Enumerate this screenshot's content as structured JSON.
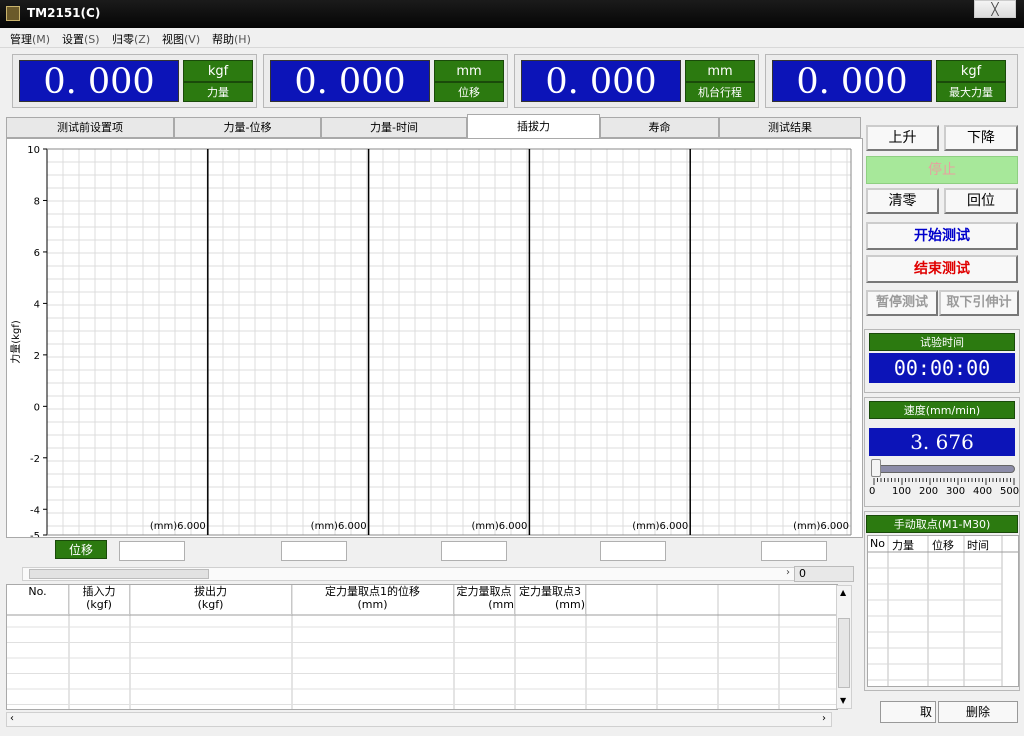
{
  "window": {
    "title": "TM2151(C)",
    "close": "╳"
  },
  "menu": [
    {
      "label": "管理",
      "acc": "(M)"
    },
    {
      "label": "设置",
      "acc": "(S)"
    },
    {
      "label": "归零",
      "acc": "(Z)"
    },
    {
      "label": "视图",
      "acc": "(V)"
    },
    {
      "label": "帮助",
      "acc": "(H)"
    }
  ],
  "displays": [
    {
      "value": "0. 000",
      "unit": "kgf",
      "label": "力量"
    },
    {
      "value": "0. 000",
      "unit": "mm",
      "label": "位移"
    },
    {
      "value": "0. 000",
      "unit": "mm",
      "label": "机台行程"
    },
    {
      "value": "0. 000",
      "unit": "kgf",
      "label": "最大力量"
    }
  ],
  "tabs": [
    "测试前设置项",
    "力量-位移",
    "力量-时间",
    "插拔力",
    "寿命",
    "测试结果"
  ],
  "active_tab": "插拔力",
  "chart_data": {
    "type": "line",
    "ylabel": "力量(kgf)",
    "ylim": [
      -5,
      10
    ],
    "y_ticks": [
      "10",
      "8",
      "6",
      "4",
      "2",
      "0",
      "-2",
      "-4",
      "-5"
    ],
    "x_panel_labels": [
      "(mm)6.000",
      "(mm)6.000",
      "(mm)6.000",
      "(mm)6.000",
      "(mm)6.000"
    ],
    "panels": 5,
    "grid": true,
    "series": []
  },
  "chart_footer": {
    "label": "位移",
    "scroll_value": "0"
  },
  "results_table": {
    "headers": [
      {
        "top": "No.",
        "bottom": ""
      },
      {
        "top": "插入力",
        "bottom": "(kgf)"
      },
      {
        "top": "拔出力",
        "bottom": "(kgf)"
      },
      {
        "top": "定力量取点1的位移",
        "bottom": "(mm)"
      },
      {
        "top": "定力量取点",
        "bottom": "(mm"
      },
      {
        "top": "定力量取点3",
        "bottom": "(mm)"
      },
      {
        "top": "",
        "bottom": ""
      },
      {
        "top": "",
        "bottom": ""
      },
      {
        "top": "",
        "bottom": ""
      },
      {
        "top": "",
        "bottom": ""
      }
    ]
  },
  "controls": {
    "up": "上升",
    "down": "下降",
    "stop": "停止",
    "zero": "清零",
    "reset": "回位",
    "start": "开始测试",
    "end": "结束测试",
    "pause": "暂停测试",
    "remove_ext": "取下引伸计"
  },
  "timer": {
    "label": "试验时间",
    "value": "00:00:00"
  },
  "speed": {
    "label": "速度(mm/min)",
    "value": "3. 676",
    "ticks": [
      "0",
      "100",
      "200",
      "300",
      "400",
      "500"
    ],
    "level": 0.007
  },
  "manual_points": {
    "title": "手动取点(M1-M30)",
    "columns": [
      "No",
      "力量",
      "位移",
      "时间"
    ],
    "btn_take": "取",
    "btn_delete": "删除"
  },
  "colors": {
    "display_blue": "#0c14b8",
    "label_green": "#2c7a10",
    "stop_green": "#a7e89a",
    "end_red": "#e00000",
    "start_blue": "#0000cc"
  }
}
